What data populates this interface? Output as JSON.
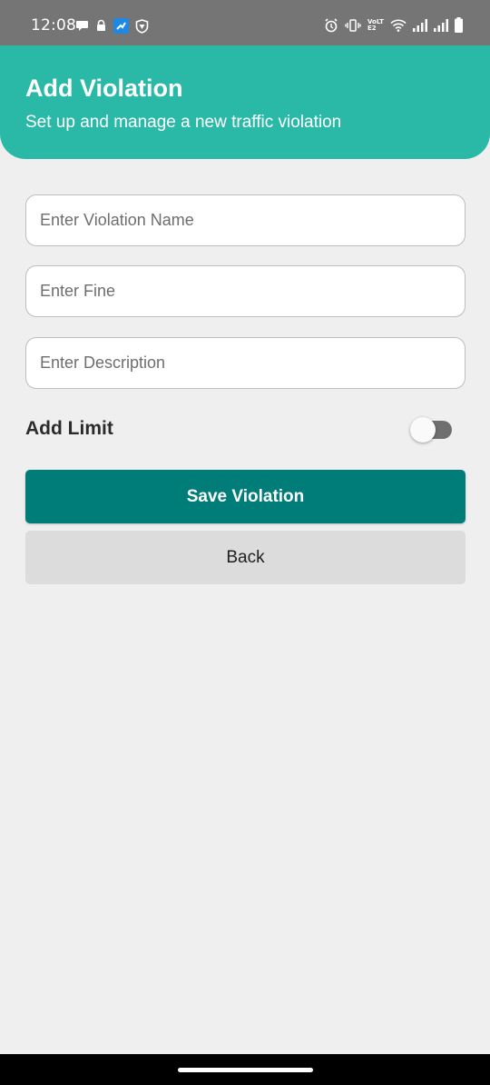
{
  "status_bar": {
    "time": "12:08",
    "left_icons": [
      "chat-bubble-icon",
      "lock-icon",
      "app-notification-icon",
      "vpn-shield-icon"
    ],
    "right_icons": [
      "alarm-icon",
      "vibrate-icon",
      "volte-icon",
      "wifi-icon",
      "signal-icon",
      "signal-icon",
      "battery-icon"
    ],
    "volte_label": "VoLTE2"
  },
  "header": {
    "title": "Add Violation",
    "subtitle": "Set up and manage a new traffic violation",
    "color": "#2bb9a7"
  },
  "form": {
    "violation_name_placeholder": "Enter Violation Name",
    "violation_name_value": "",
    "fine_placeholder": "Enter Fine",
    "fine_value": "",
    "description_placeholder": "Enter Description",
    "description_value": "",
    "add_limit_label": "Add Limit",
    "add_limit_enabled": false
  },
  "actions": {
    "save_label": "Save Violation",
    "save_color": "#007d79",
    "back_label": "Back"
  }
}
